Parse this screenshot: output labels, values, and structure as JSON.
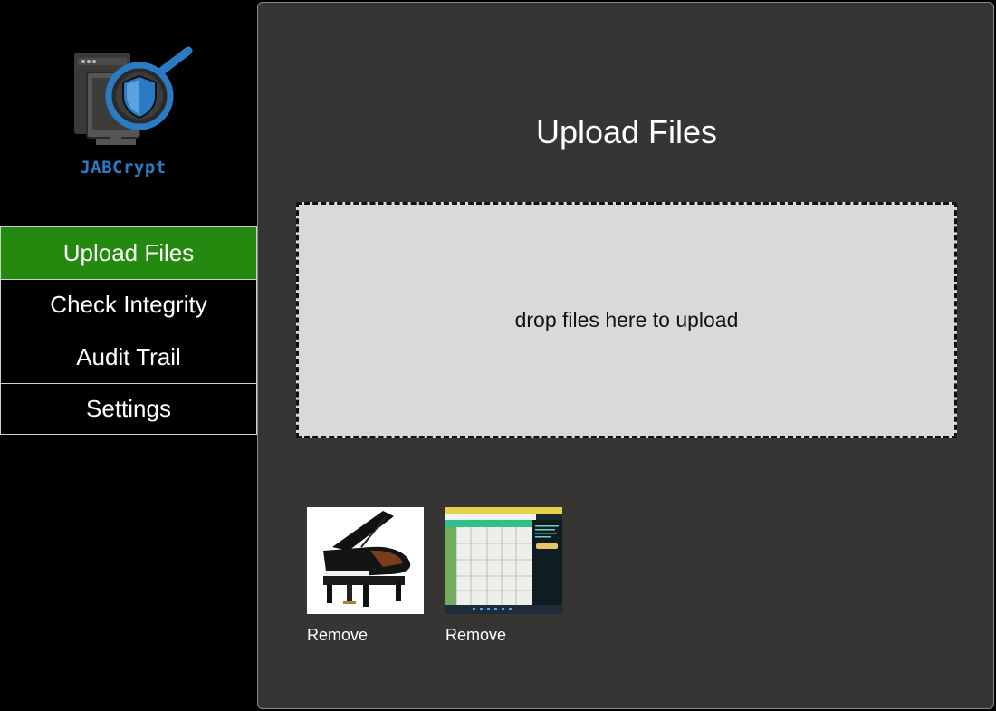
{
  "app": {
    "name": "JABCrypt",
    "brand_color": "#2a7bc4",
    "accent_color": "#238a0f"
  },
  "sidebar": {
    "items": [
      {
        "label": "Upload Files",
        "active": true
      },
      {
        "label": "Check Integrity",
        "active": false
      },
      {
        "label": "Audit Trail",
        "active": false
      },
      {
        "label": "Settings",
        "active": false
      }
    ]
  },
  "main": {
    "title": "Upload Files",
    "dropzone": {
      "text": "drop files here to upload"
    },
    "files": [
      {
        "thumbnail": "grand-piano-image",
        "remove_label": "Remove"
      },
      {
        "thumbnail": "spreadsheet-screenshot-image",
        "remove_label": "Remove"
      }
    ]
  }
}
